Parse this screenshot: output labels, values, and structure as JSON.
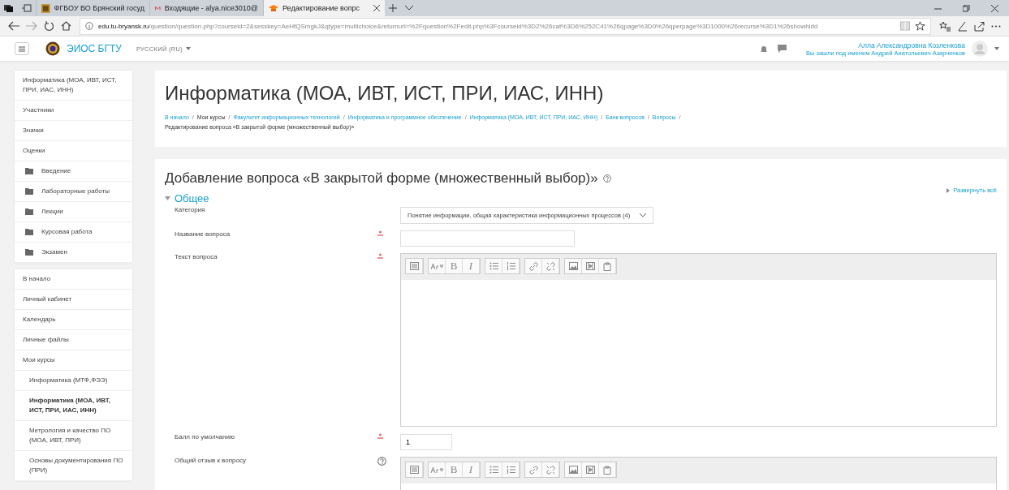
{
  "browser": {
    "tabs": [
      {
        "title": "ФГБОУ ВО Брянский госуд",
        "kind": "site",
        "selected": false
      },
      {
        "title": "Входящие - alya.nice3010@",
        "kind": "mail",
        "selected": false
      },
      {
        "title": "Редактирование вопрс",
        "kind": "moodle",
        "selected": true
      }
    ],
    "address_host": "edu.tu-bryansk.ru",
    "address_path": "/question/question.php?courseid=2&sesskey=AeHfQSmgkJ&qtype=multichoice&returnurl=%2Fquestion%2Fedit.php%3Fcourseid%3D2%26cat%3D6%252C41%26qpage%3D0%26qperpage%3D1000%26recurse%3D1%26showhidd"
  },
  "navbar": {
    "site_name": "ЭИОС БГТУ",
    "language": "РУССКИЙ (RU)",
    "user_name": "Алла Александровна Козленкова",
    "login_note": "Вы зашли под именем Андрей Анатольевич Азарченков"
  },
  "sidebar": {
    "blocks": [
      {
        "items": [
          {
            "label": "Информатика (МОА, ИВТ, ИСТ, ПРИ, ИАС, ИНН)",
            "kind": "link"
          },
          {
            "label": "Участники",
            "kind": "link"
          },
          {
            "label": "Значки",
            "kind": "link"
          },
          {
            "label": "Оценки",
            "kind": "link"
          },
          {
            "label": "Введение",
            "kind": "section"
          },
          {
            "label": "Лабораторные работы",
            "kind": "section"
          },
          {
            "label": "Лекции",
            "kind": "section"
          },
          {
            "label": "Курсовая работа",
            "kind": "section"
          },
          {
            "label": "Экзамен",
            "kind": "section"
          }
        ]
      },
      {
        "items": [
          {
            "label": "В начало",
            "kind": "link"
          },
          {
            "label": "Личный кабинет",
            "kind": "link"
          },
          {
            "label": "Календарь",
            "kind": "link"
          },
          {
            "label": "Личные файлы",
            "kind": "link"
          },
          {
            "label": "Мои курсы",
            "kind": "link",
            "children": [
              {
                "label": "Информатика (МТФ,ФЭЭ)",
                "selected": false
              },
              {
                "label": "Информатика (МОА, ИВТ, ИСТ, ПРИ, ИАС, ИНН)",
                "selected": true
              },
              {
                "label": "Метрология и качество ПО (МОА, ИВТ, ПРИ)",
                "selected": false
              },
              {
                "label": "Основы документирования ПО (ПРИ)",
                "selected": false
              }
            ]
          }
        ]
      }
    ]
  },
  "header": {
    "title": "Информатика (МОА, ИВТ, ИСТ, ПРИ, ИАС, ИНН)",
    "breadcrumbs": [
      {
        "label": "В начало",
        "link": true
      },
      {
        "separator": "/",
        "label": "Мои курсы",
        "link": false
      },
      {
        "separator": "/",
        "label": "Факультет информационных технологий",
        "link": true
      },
      {
        "separator": "/",
        "label": "Информатика и программное обеспечение",
        "link": true
      },
      {
        "separator": "/",
        "label": "Информатика (МОА, ИВТ, ИСТ, ПРИ, ИАС, ИНН)",
        "link": true
      },
      {
        "separator": "/",
        "label": "Банк вопросов",
        "link": true
      },
      {
        "separator": "/",
        "label": "Вопросы",
        "link": true
      },
      {
        "separator": "/",
        "label": "Редактирование вопроса «В закрытой форме (множественный выбор)»",
        "link": false
      }
    ]
  },
  "form": {
    "heading": "Добавление вопроса «В закрытой форме (множественный выбор)»",
    "expand_all": "Развернуть всё",
    "section": {
      "title": "Общее",
      "expanded": true
    },
    "fields": [
      {
        "label": "Категория",
        "kind": "select",
        "required": false,
        "help": false,
        "value": "Понятие информации, общая характеристика информационных процессов (4)"
      },
      {
        "label": "Название вопроса",
        "kind": "text",
        "required": true,
        "help": false
      },
      {
        "label": "Текст вопроса",
        "kind": "editor",
        "required": true,
        "help": false,
        "tall": true,
        "toolbar_groups": [
          [
            {
              "kind": "collapse"
            }
          ],
          [
            {
              "kind": "style"
            },
            {
              "kind": "letter",
              "label": "B",
              "italic": false
            },
            {
              "kind": "letter",
              "label": "I",
              "italic": true
            }
          ],
          [
            {
              "kind": "bullets"
            },
            {
              "kind": "numbers"
            }
          ],
          [
            {
              "kind": "link"
            },
            {
              "kind": "unlink"
            }
          ],
          [
            {
              "kind": "image"
            },
            {
              "kind": "media"
            },
            {
              "kind": "paste"
            }
          ]
        ]
      },
      {
        "label": "Балл по умолчанию",
        "kind": "number",
        "required": true,
        "help": false,
        "value": "1"
      },
      {
        "label": "Общий отзыв к вопросу",
        "kind": "editor",
        "required": false,
        "help": true,
        "tall": false,
        "toolbar_groups": [
          [
            {
              "kind": "collapse"
            }
          ],
          [
            {
              "kind": "style"
            },
            {
              "kind": "letter",
              "label": "B",
              "italic": false
            },
            {
              "kind": "letter",
              "label": "I",
              "italic": true
            }
          ],
          [
            {
              "kind": "bullets"
            },
            {
              "kind": "numbers"
            }
          ],
          [
            {
              "kind": "link"
            },
            {
              "kind": "unlink"
            }
          ],
          [
            {
              "kind": "image"
            },
            {
              "kind": "media"
            },
            {
              "kind": "paste"
            }
          ]
        ]
      }
    ]
  }
}
